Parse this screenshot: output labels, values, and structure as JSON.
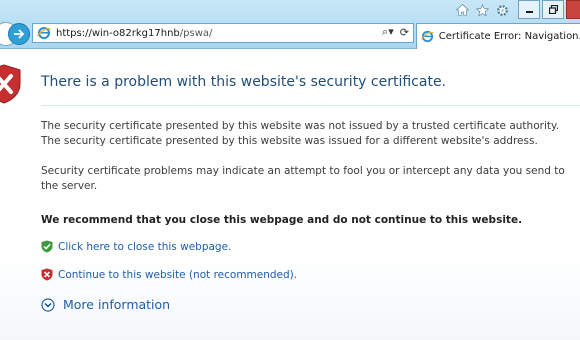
{
  "browser": {
    "url_host": "https://win-o82rkg17hnb",
    "url_path": "/pswa/",
    "tab_title": "Certificate Error: Navigation...",
    "refresh_glyph": "⟳",
    "search_glyph": "⌕",
    "dropdown_glyph": "▾",
    "caption_icons": [
      "home-icon",
      "favorites-star-icon",
      "tools-gear-icon"
    ],
    "window_buttons": [
      "minimize",
      "restore",
      "close"
    ]
  },
  "page": {
    "title": "There is a problem with this website's security certificate.",
    "paragraph1_line1": "The security certificate presented by this website was not issued by a trusted certificate authority.",
    "paragraph1_line2": "The security certificate presented by this website was issued for a different website's address.",
    "paragraph2": "Security certificate problems may indicate an attempt to fool you or intercept any data you send to the server.",
    "recommendation": "We recommend that you close this webpage and do not continue to this website.",
    "close_link": "Click here to close this webpage.",
    "continue_link": "Continue to this website (not recommended).",
    "more_info": "More information"
  },
  "colors": {
    "accent_link": "#1d5ea8",
    "title": "#1f4e79",
    "shield_red": "#c62f2f",
    "shield_green": "#3b9a3b"
  }
}
